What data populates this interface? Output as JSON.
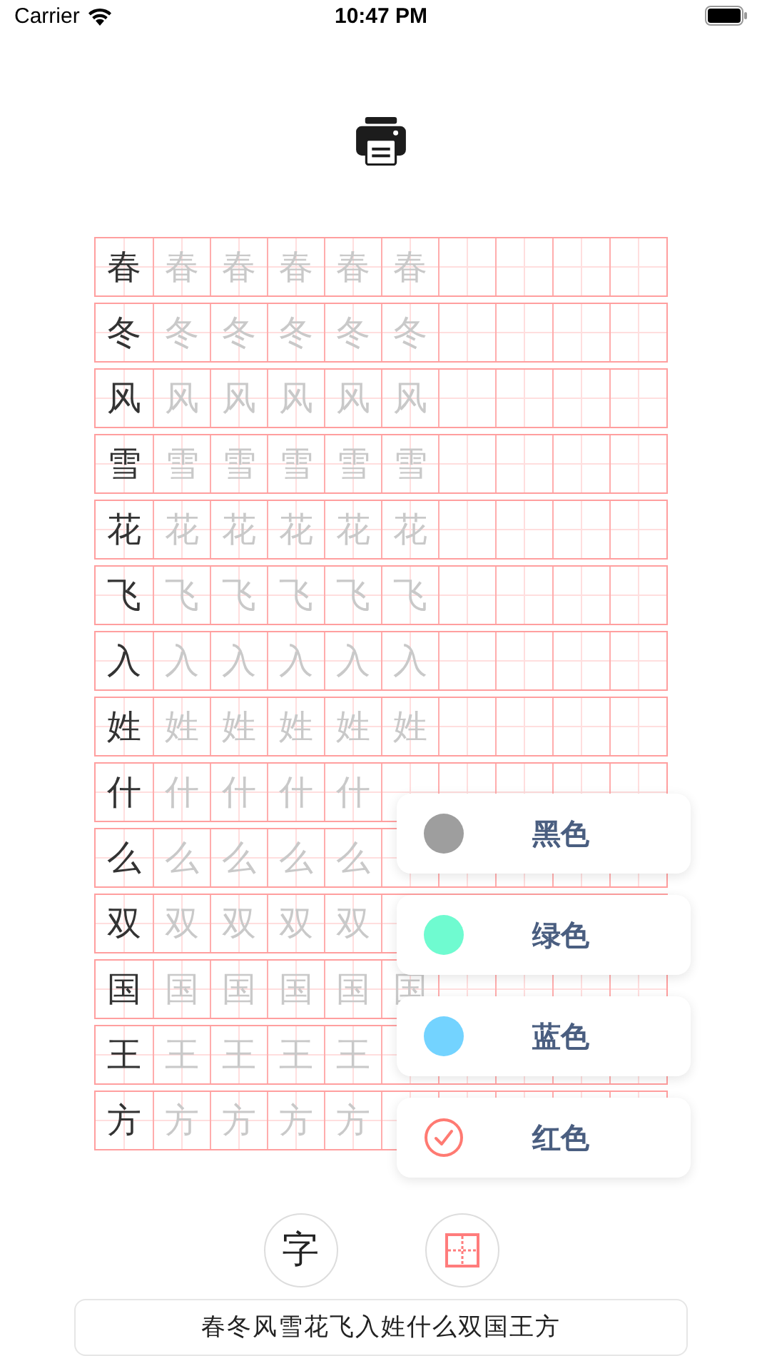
{
  "status_bar": {
    "carrier": "Carrier",
    "time": "10:47 PM"
  },
  "practice_rows": [
    {
      "character": "春",
      "traces": [
        "春",
        "春",
        "春",
        "春",
        "春"
      ]
    },
    {
      "character": "冬",
      "traces": [
        "冬",
        "冬",
        "冬",
        "冬",
        "冬"
      ]
    },
    {
      "character": "风",
      "traces": [
        "风",
        "风",
        "风",
        "风",
        "风"
      ]
    },
    {
      "character": "雪",
      "traces": [
        "雪",
        "雪",
        "雪",
        "雪",
        "雪"
      ]
    },
    {
      "character": "花",
      "traces": [
        "花",
        "花",
        "花",
        "花",
        "花"
      ]
    },
    {
      "character": "飞",
      "traces": [
        "飞",
        "飞",
        "飞",
        "飞",
        "飞"
      ]
    },
    {
      "character": "入",
      "traces": [
        "入",
        "入",
        "入",
        "入",
        "入"
      ]
    },
    {
      "character": "姓",
      "traces": [
        "姓",
        "姓",
        "姓",
        "姓",
        "姓"
      ]
    },
    {
      "character": "什",
      "traces": [
        "什",
        "什",
        "什",
        "什"
      ]
    },
    {
      "character": "么",
      "traces": [
        "么",
        "么",
        "么",
        "么"
      ]
    },
    {
      "character": "双",
      "traces": [
        "双",
        "双",
        "双",
        "双"
      ]
    },
    {
      "character": "国",
      "traces": [
        "国",
        "国",
        "国",
        "国",
        "国"
      ]
    },
    {
      "character": "王",
      "traces": [
        "王",
        "王",
        "王",
        "王"
      ]
    },
    {
      "character": "方",
      "traces": [
        "方",
        "方",
        "方",
        "方"
      ]
    }
  ],
  "color_menu": [
    {
      "label": "黑色",
      "color": "#9e9e9e",
      "selected": false
    },
    {
      "label": "绿色",
      "color": "#6ffbd0",
      "selected": false
    },
    {
      "label": "蓝色",
      "color": "#73d3ff",
      "selected": false
    },
    {
      "label": "红色",
      "color": "#ff7a72",
      "selected": true
    }
  ],
  "buttons": [
    {
      "kind": "text",
      "label": "字"
    },
    {
      "kind": "grid"
    }
  ],
  "input": {
    "value": "春冬风雪花飞入姓什么双国王方"
  }
}
